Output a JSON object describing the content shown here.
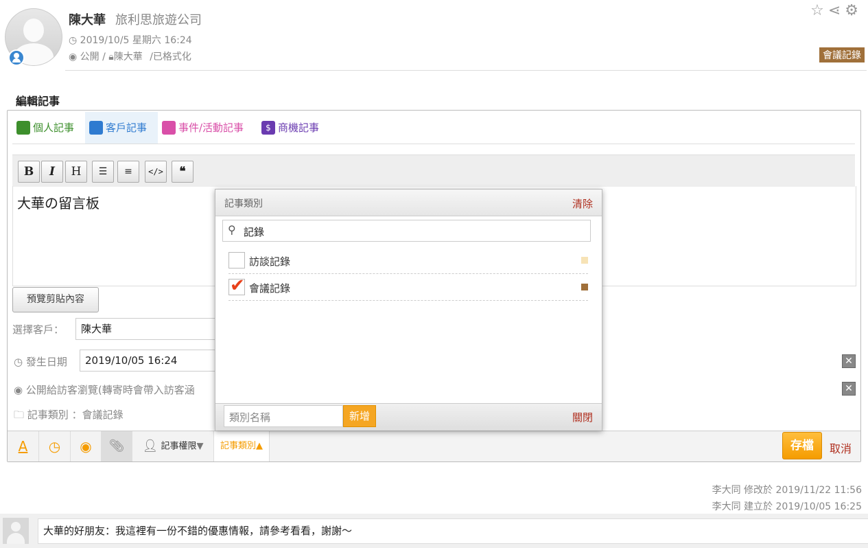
{
  "header": {
    "name": "陳大華",
    "company": "旅利思旅遊公司",
    "datetime": "2019/10/5 星期六 16:24",
    "visibility": "公開",
    "owner": "陳大華",
    "status": "/已格式化",
    "tag": "會議記錄"
  },
  "section_title": "編輯記事",
  "tabs": [
    {
      "label": "個人記事",
      "color": "#3d8f2c"
    },
    {
      "label": "客戶記事",
      "color": "#2f7bd0"
    },
    {
      "label": "事件/活動記事",
      "color": "#d94fa8"
    },
    {
      "label": "商機記事",
      "color": "#6a3bb0"
    }
  ],
  "toolbar": {
    "bold": "B",
    "italic": "I",
    "heading": "H"
  },
  "editor": {
    "content": "大華の留言板"
  },
  "preview_button": "預覽剪貼內容",
  "form": {
    "client_label": "選擇客戶：",
    "client_value": "陳大華",
    "date_label": "發生日期",
    "date_value": "2019/10/05 16:24",
    "public_label": "公開給訪客瀏覽(轉寄時會帶入訪客涵",
    "category_label": "記事類別 ：會議記錄"
  },
  "bottom_bar": {
    "permission": "記事權限",
    "category": "記事類別",
    "save": "存檔",
    "cancel": "取消"
  },
  "popup": {
    "title": "記事類別",
    "clear": "清除",
    "search_value": "記錄",
    "items": [
      {
        "label": "訪談記錄",
        "checked": false,
        "color": "#f7e3b6"
      },
      {
        "label": "會議記錄",
        "checked": true,
        "color": "#a0703a"
      }
    ],
    "new_placeholder": "類別名稱",
    "add": "新增",
    "close": "關閉"
  },
  "footer": {
    "modified": "李大同 修改於 2019/11/22 11:56",
    "created": "李大同 建立於 2019/10/05 16:25"
  },
  "comment": {
    "text": "大華的好朋友：我這裡有一份不錯的優惠情報，請參考看看，謝謝～"
  }
}
